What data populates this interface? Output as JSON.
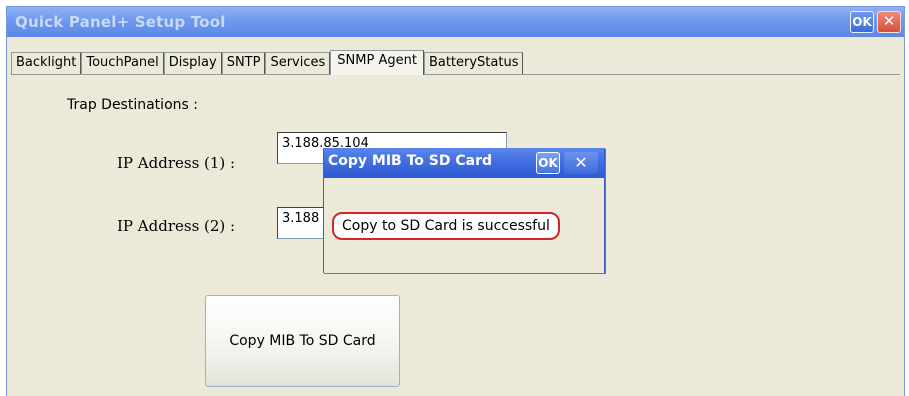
{
  "window": {
    "title": "Quick Panel+ Setup Tool",
    "ok_label": "OK",
    "close_glyph": "✕"
  },
  "tabs": [
    {
      "label": "Backlight",
      "active": false
    },
    {
      "label": "TouchPanel",
      "active": false
    },
    {
      "label": "Display",
      "active": false
    },
    {
      "label": "SNTP",
      "active": false
    },
    {
      "label": "Services",
      "active": false
    },
    {
      "label": "SNMP Agent",
      "active": true
    },
    {
      "label": "BatteryStatus",
      "active": false
    }
  ],
  "snmp": {
    "trap_label": "Trap Destinations :",
    "ip1_label": "IP Address (1) :",
    "ip1_value": "3.188.85.104",
    "ip2_label": "IP Address (2) :",
    "ip2_value": "3.188",
    "copy_button_label": "Copy MIB To SD Card"
  },
  "dialog": {
    "title": "Copy MIB To SD Card",
    "ok_label": "OK",
    "close_glyph": "✕",
    "message": "Copy to SD Card is successful"
  },
  "colors": {
    "titlebar": "#6e98ee",
    "dialog_titlebar": "#3f6ce0",
    "highlight_outline": "#d9232a",
    "background": "#ece9d8"
  }
}
